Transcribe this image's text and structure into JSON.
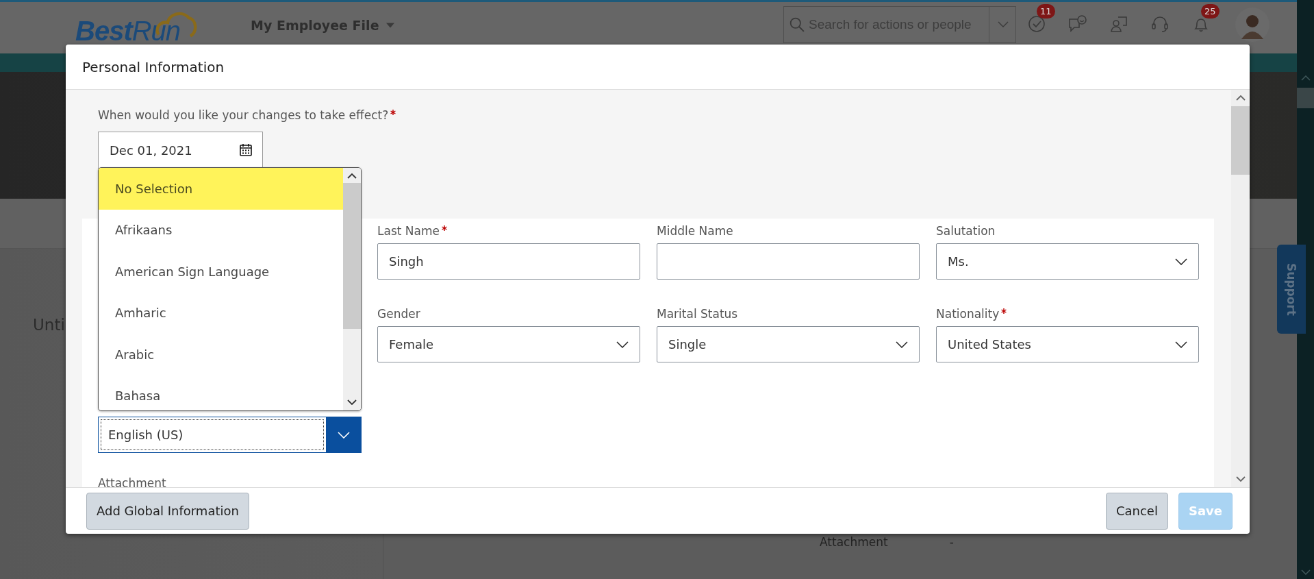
{
  "header": {
    "logo": "**Best**Run",
    "app_menu": "My Employee File",
    "search": {
      "placeholder": "Search for actions or people"
    },
    "icons": [
      {
        "kind": "tasks",
        "badge": "11"
      },
      {
        "kind": "feedback"
      },
      {
        "kind": "people"
      },
      {
        "kind": "support"
      },
      {
        "kind": "notifications",
        "badge": "25"
      }
    ]
  },
  "page": {
    "title_fragment": "Unti",
    "attachment_label": "Attachment",
    "attachment_value": "-",
    "support_tab": "Support"
  },
  "dialog": {
    "title": "Personal Information",
    "effective_date": {
      "label": "When would you like your changes to take effect?",
      "required": true,
      "value": "Dec 01, 2021"
    },
    "rows": [
      [
        {
          "label": "Last Name",
          "required": true,
          "kind": "text",
          "value": "Singh"
        },
        {
          "label": "Middle Name",
          "required": false,
          "kind": "text"
        },
        {
          "label": "Salutation",
          "required": false,
          "kind": "select",
          "value": "Ms."
        }
      ],
      [
        {
          "label": "Gender",
          "required": false,
          "kind": "select",
          "value": "Female"
        },
        {
          "label": "Marital Status",
          "required": false,
          "kind": "select",
          "value": "Single"
        },
        {
          "label": "Nationality",
          "required": true,
          "kind": "select",
          "value": "United States"
        }
      ]
    ],
    "language": {
      "value": "English (US)",
      "focused": true
    },
    "options": [
      {
        "label": "No Selection",
        "selected": true
      },
      {
        "label": "Afrikaans",
        "selected": false
      },
      {
        "label": "American Sign Language",
        "selected": false
      },
      {
        "label": "Amharic",
        "selected": false
      },
      {
        "label": "Arabic",
        "selected": false
      },
      {
        "label": "Bahasa",
        "selected": false
      }
    ],
    "attachment_label": "Attachment",
    "buttons": [
      {
        "label": "Add Global Information",
        "kind": "secondary",
        "disabled": false
      },
      {
        "label": "Cancel",
        "kind": "secondary",
        "disabled": false
      },
      {
        "label": "Save",
        "kind": "primary",
        "disabled": true
      }
    ]
  }
}
